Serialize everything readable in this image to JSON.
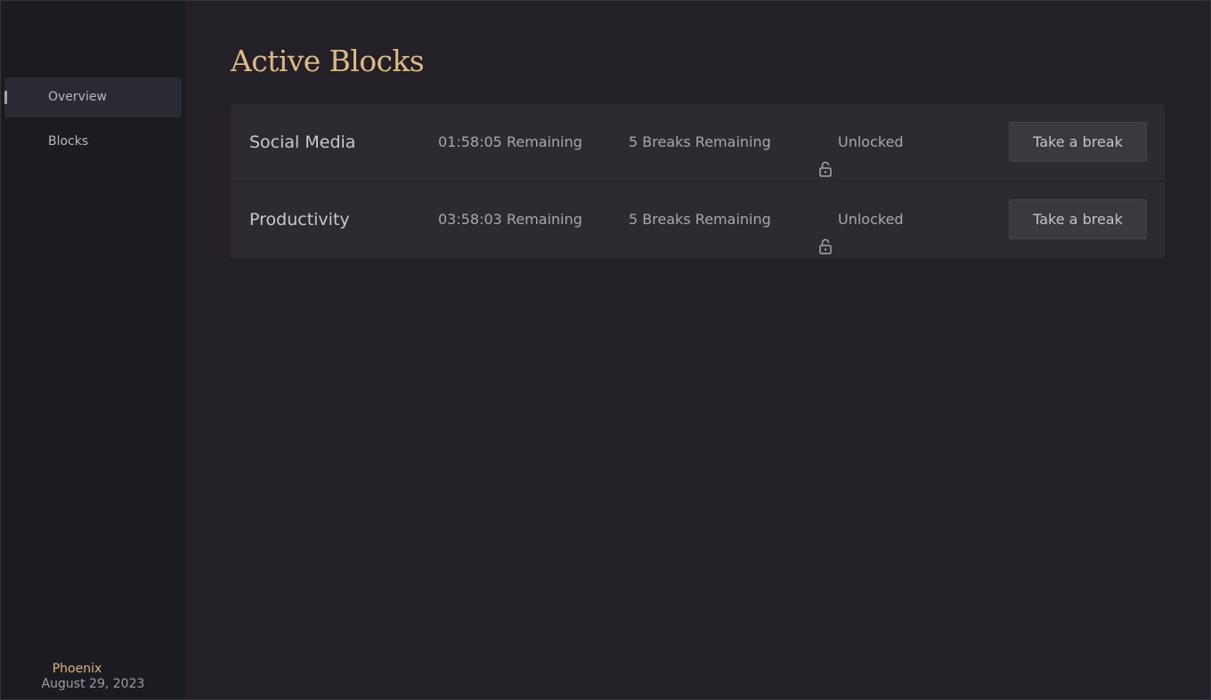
{
  "sidebar": {
    "items": [
      {
        "label": "Overview"
      },
      {
        "label": "Blocks"
      }
    ],
    "footer": {
      "user": "Phoenix",
      "date": "August 29, 2023"
    }
  },
  "main": {
    "title": "Active Blocks",
    "blocks": [
      {
        "name": "Social Media",
        "time_remaining": "01:58:05 Remaining",
        "breaks_remaining": "5 Breaks Remaining",
        "status": "Unlocked",
        "status_icon": "unlocked-padlock-icon",
        "action": "Take a break"
      },
      {
        "name": "Productivity",
        "time_remaining": "03:58:03 Remaining",
        "breaks_remaining": "5 Breaks Remaining",
        "status": "Unlocked",
        "status_icon": "unlocked-padlock-icon",
        "action": "Take a break"
      }
    ]
  },
  "colors": {
    "accent": "#ddb983",
    "sidebar_bg": "#1b1b22",
    "main_bg": "#232127",
    "card_bg": "#2c2b31"
  }
}
